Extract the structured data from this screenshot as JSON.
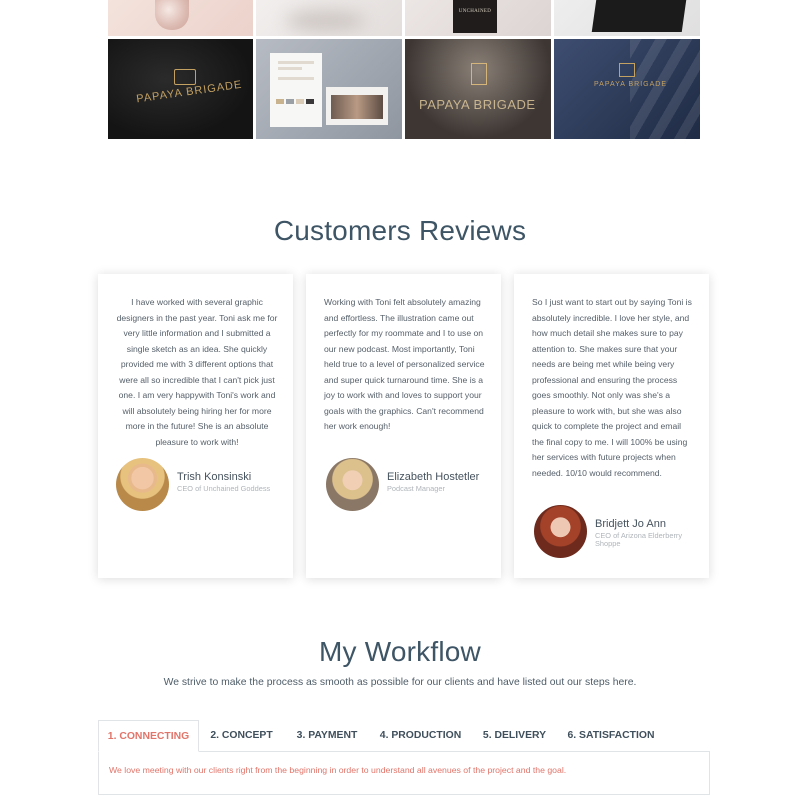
{
  "portfolio": {
    "tile_texts": {
      "unchained_card": "UNCHAINED",
      "brand_stationery": "PAPAYA BRIGADE",
      "brand_window": "PAPAYA BRIGADE",
      "brand_wall": "PAPAYA BRIGADE"
    }
  },
  "reviews": {
    "title": "Customers Reviews",
    "items": [
      {
        "text": "I have worked with several graphic designers in the past year. Toni ask me for very little information and I submitted a single sketch as an idea. She quickly provided me with 3 different options that were all so incredible that I can't pick just one. I am very happywith Toni's work and will absolutely being hiring her for more more in the future! She is an absolute pleasure to work with!",
        "name": "Trish Konsinski",
        "role": "CEO of Unchained Goddess"
      },
      {
        "text": "Working with Toni felt absolutely amazing and effortless. The illustration came out perfectly for my roommate and I to use on our new podcast. Most importantly, Toni held true to a level of personalized service and super quick turnaround time. She is a joy to work with and loves to support your goals with the graphics. Can't recommend her work enough!",
        "name": "Elizabeth Hostetler",
        "role": "Podcast Manager"
      },
      {
        "text": "So I just want to start out by saying Toni is absolutely incredible. I love her style, and how much detail she makes sure to pay attention to. She makes sure that your needs are being met while being very professional and ensuring the process goes smoothly. Not only was she's a pleasure to work with, but she was also quick to complete the project and email the final copy to me. I will 100% be using her services with future projects when needed. 10/10 would recommend.",
        "name": "Bridjett Jo Ann",
        "role": "CEO of Arizona Elderberry Shoppe"
      }
    ]
  },
  "workflow": {
    "title": "My Workflow",
    "subtitle": "We strive to make the process as smooth as possible for our clients and have listed out our steps here.",
    "tabs": [
      "1. CONNECTING",
      "2. CONCEPT",
      "3. PAYMENT",
      "4. PRODUCTION",
      "5. DELIVERY",
      "6. SATISFACTION"
    ],
    "active_tab": 0,
    "active_content": "We love meeting with our clients right from the beginning in order to understand all avenues of the project and the goal."
  },
  "colors": {
    "accent": "#e1756a",
    "heading": "#3e5566",
    "body_text": "#56606a"
  }
}
